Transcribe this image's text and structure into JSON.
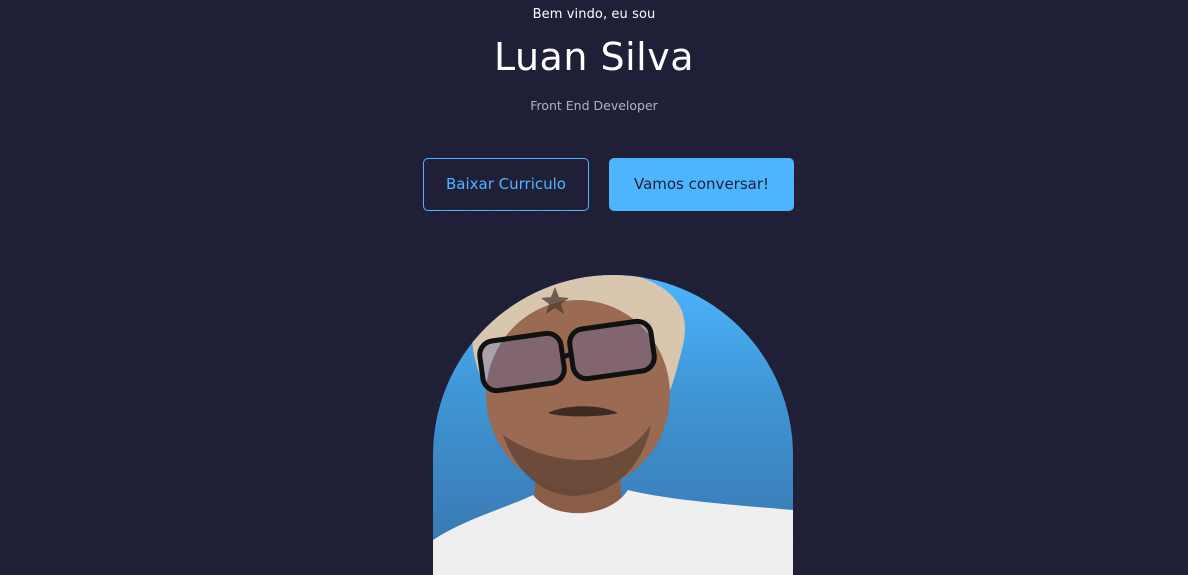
{
  "header": {
    "greeting": "Bem vindo, eu sou",
    "name": "Luan Silva",
    "role": "Front End Developer"
  },
  "actions": {
    "download_cv_label": "Baixar Curriculo",
    "contact_label": "Vamos conversar!"
  },
  "colors": {
    "background": "#1f1f38",
    "primary": "#4db5ff",
    "text": "#ffffff"
  },
  "profile": {
    "image_alt": "Luan Silva"
  }
}
